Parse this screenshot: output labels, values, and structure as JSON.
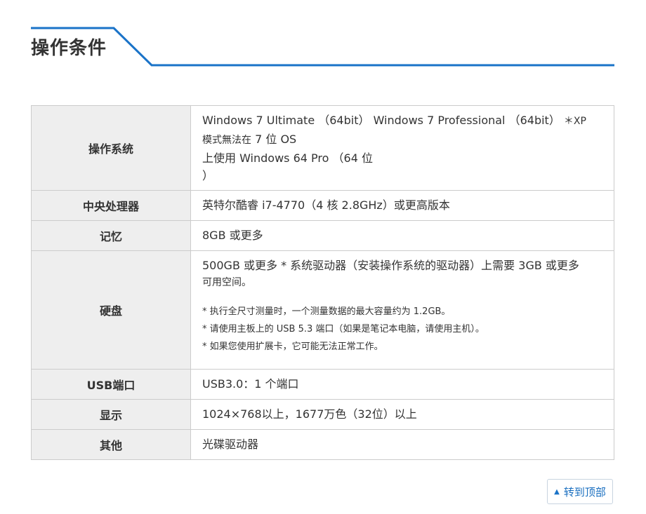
{
  "heading": "操作条件",
  "rows": [
    {
      "label": "操作系统",
      "os_line1": "Windows 7 Ultimate （64bit） Windows 7 Professional （64bit）",
      "os_note_inline": "＊XP",
      "os_line2a": "模式無法在",
      "os_line2b": " 7 位 OS",
      "os_line3": "上使用 Windows 64 Pro （64 位",
      "os_line4": "）"
    },
    {
      "label": "中央处理器",
      "value": "英特尔酷睿 i7-4770（4 核 2.8GHz）或更高版本"
    },
    {
      "label": "记忆",
      "value": "8GB 或更多"
    },
    {
      "label": "硬盘",
      "line1": "500GB 或更多 * 系统驱动器（安装操作系统的驱动器）上需要 3GB 或更多",
      "line2": "可用空间。",
      "notes": [
        "* 执行全尺寸测量时，一个测量数据的最大容量约为 1.2GB。",
        "* 请使用主板上的 USB 5.3 端口（如果是笔记本电脑，请使用主机）。",
        "* 如果您使用扩展卡，它可能无法正常工作。"
      ]
    },
    {
      "label": "USB端口",
      "value": "USB3.0：1 个端口"
    },
    {
      "label": "显示",
      "value": "1024×768以上，1677万色（32位）以上"
    },
    {
      "label": "其他",
      "value": "光碟驱动器"
    }
  ],
  "back_to_top": {
    "icon": "triangle-up-icon",
    "label": "转到顶部"
  },
  "colors": {
    "accent": "#1a73c8",
    "header_bg": "#eeeeee",
    "border": "#cccccc"
  }
}
